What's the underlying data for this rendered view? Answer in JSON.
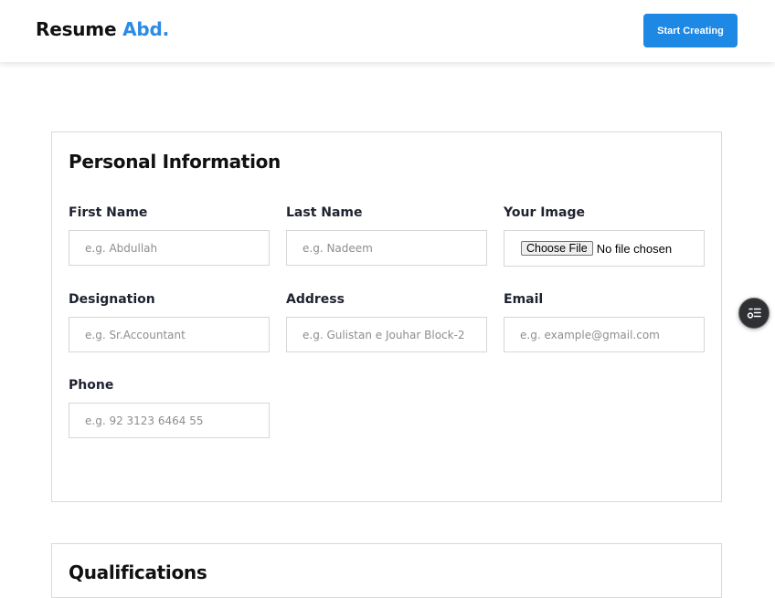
{
  "navbar": {
    "brand_main": "Resume ",
    "brand_accent": "Abd.",
    "cta_label": "Start Creating"
  },
  "personal": {
    "title": "Personal Information",
    "fields": {
      "first_name": {
        "label": "First Name",
        "placeholder": "e.g. Abdullah"
      },
      "last_name": {
        "label": "Last Name",
        "placeholder": "e.g. Nadeem"
      },
      "image": {
        "label": "Your Image",
        "button": "Choose File",
        "status": "No file chosen"
      },
      "designation": {
        "label": "Designation",
        "placeholder": "e.g. Sr.Accountant"
      },
      "address": {
        "label": "Address",
        "placeholder": "e.g. Gulistan e Jouhar Block-2"
      },
      "email": {
        "label": "Email",
        "placeholder": "e.g. example@gmail.com"
      },
      "phone": {
        "label": "Phone",
        "placeholder": "e.g. 92 3123 6464 55"
      }
    }
  },
  "qualifications": {
    "title": "Qualifications"
  },
  "floating": {
    "icon": "settings-list-icon",
    "color": "#2f3033"
  },
  "colors": {
    "accent": "#2b8be6",
    "button": "#1e88e5"
  }
}
